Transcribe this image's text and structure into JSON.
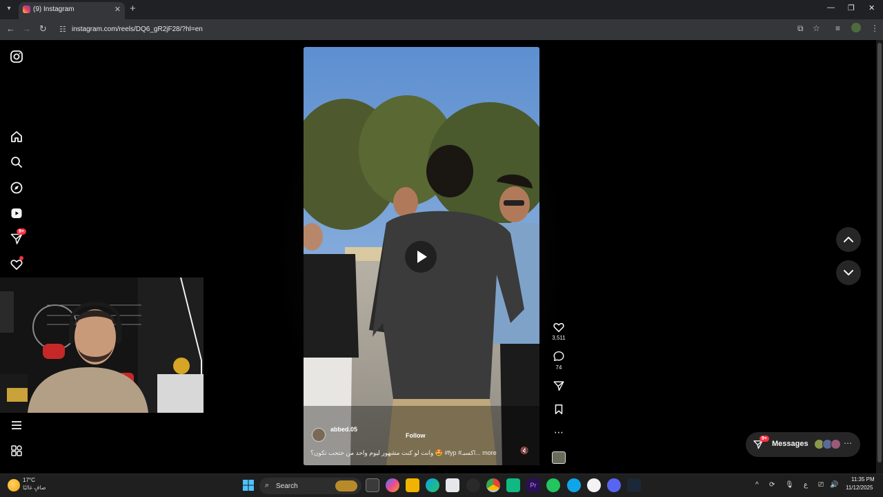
{
  "browser": {
    "tab_title": "(9) Instagram",
    "url": "instagram.com/reels/DQ6_gR2jF28/?hl=en"
  },
  "sidebar": {
    "notifications_badge": "9+"
  },
  "reel": {
    "username": "abbed.05",
    "follow_label": "Follow",
    "caption": "وانت لو كنت مشهور ليوم واحد من حتحب تكون؟ 🤩 #fyp #اكسبـ... more"
  },
  "actions": {
    "likes": "3,511",
    "comments": "74"
  },
  "messages": {
    "label": "Messages",
    "badge": "9+"
  },
  "taskbar": {
    "temperature": "17°C",
    "weather": "صافٍ غالبًا",
    "search_label": "Search",
    "ime": "ع",
    "time": "11:35 PM",
    "date": "11/12/2025"
  },
  "colors": {
    "accent_red": "#ff3040",
    "page_bg": "#000000",
    "chrome_bg": "#35363a"
  }
}
